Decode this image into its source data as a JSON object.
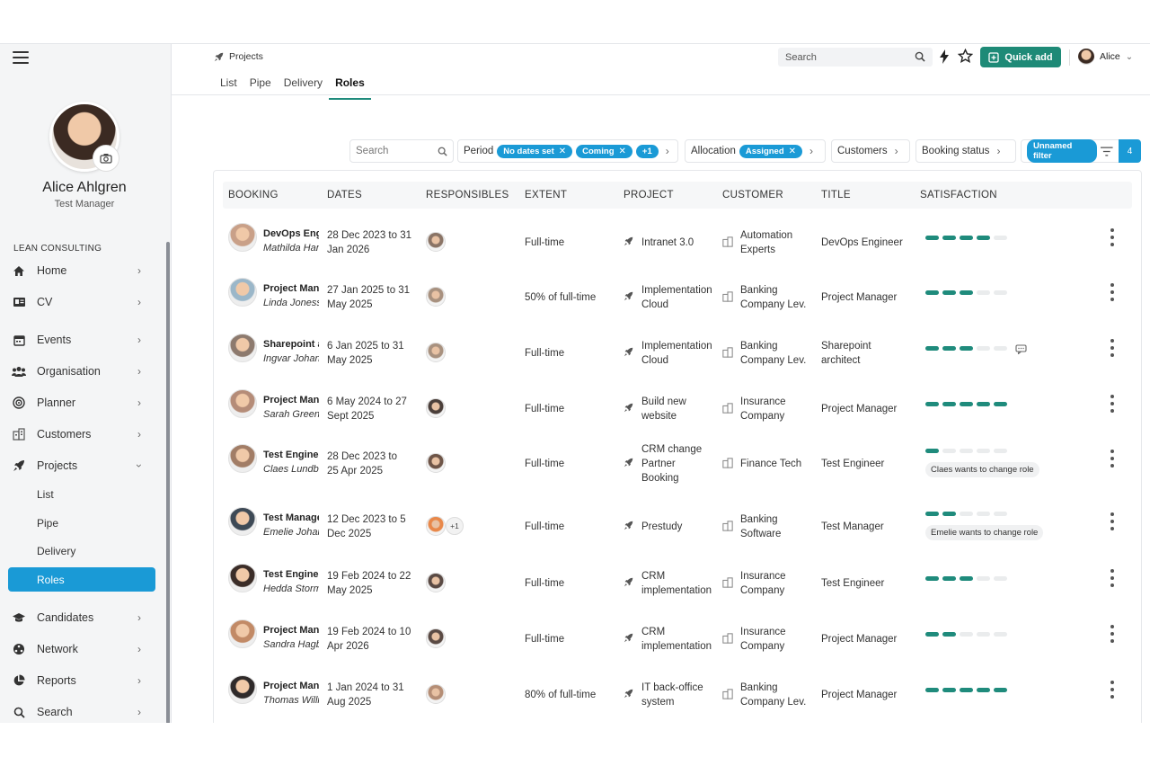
{
  "sidebar": {
    "profile_name": "Alice Ahlgren",
    "profile_role": "Test Manager",
    "org_label": "LEAN CONSULTING",
    "items": [
      {
        "label": "Home",
        "icon": "home-icon"
      },
      {
        "label": "CV",
        "icon": "cv-icon"
      },
      {
        "label": "Events",
        "icon": "calendar-icon"
      },
      {
        "label": "Organisation",
        "icon": "people-icon"
      },
      {
        "label": "Planner",
        "icon": "planner-icon"
      },
      {
        "label": "Customers",
        "icon": "building-icon"
      },
      {
        "label": "Projects",
        "icon": "rocket-icon"
      },
      {
        "label": "Candidates",
        "icon": "graduation-cap-icon"
      },
      {
        "label": "Network",
        "icon": "network-icon"
      },
      {
        "label": "Reports",
        "icon": "pie-chart-icon"
      },
      {
        "label": "Search",
        "icon": "search-icon"
      }
    ],
    "project_subitems": [
      "List",
      "Pipe",
      "Delivery",
      "Roles"
    ]
  },
  "header": {
    "breadcrumb": "Projects",
    "tabs": [
      "List",
      "Pipe",
      "Delivery",
      "Roles"
    ],
    "active_tab": "Roles",
    "search_placeholder": "Search",
    "quick_add_label": "Quick add",
    "user_name": "Alice"
  },
  "filters": {
    "search_placeholder": "Search",
    "period_label": "Period",
    "period_pills": [
      "No dates set",
      "Coming",
      "+1"
    ],
    "allocation_label": "Allocation",
    "allocation_pill": "Assigned",
    "customers_label": "Customers",
    "booking_status_label": "Booking status",
    "unnamed_filter": "Unnamed filter",
    "count": "4"
  },
  "table": {
    "columns": [
      "BOOKING",
      "DATES",
      "RESPONSIBLES",
      "EXTENT",
      "PROJECT",
      "CUSTOMER",
      "TITLE",
      "SATISFACTION"
    ],
    "rows": [
      {
        "role": "DevOps Engineer",
        "person": "Mathilda Hansson",
        "dates1": "28 Dec 2023 to 31",
        "dates2": "Jan 2026",
        "extent": "Full-time",
        "project1": "Intranet 3.0",
        "project2": "",
        "project3": "",
        "customer1": "Automation",
        "customer2": "Experts",
        "title1": "DevOps Engineer",
        "title2": "",
        "satisfaction": 4,
        "note": "",
        "avatar_color": "#c9a088",
        "resp_color": "#8a7466"
      },
      {
        "role": "Project Manager",
        "person": "Linda Jonesson",
        "dates1": "27 Jan 2025 to 31",
        "dates2": "May 2025",
        "extent": "50% of full-time",
        "project1": "Implementation",
        "project2": "Cloud",
        "project3": "",
        "customer1": "Banking",
        "customer2": "Company Lev.",
        "title1": "Project Manager",
        "title2": "",
        "satisfaction": 3,
        "note": "",
        "avatar_color": "#9bb7c9",
        "resp_color": "#a8917f"
      },
      {
        "role": "Sharepoint architect",
        "person": "Ingvar Johansson",
        "dates1": "6 Jan 2025 to 31",
        "dates2": "May 2025",
        "extent": "Full-time",
        "project1": "Implementation",
        "project2": "Cloud",
        "project3": "",
        "customer1": "Banking",
        "customer2": "Company Lev.",
        "title1": "Sharepoint",
        "title2": "architect",
        "satisfaction": 3,
        "note": "",
        "avatar_color": "#8d7a6e",
        "resp_color": "#a8917f"
      },
      {
        "role": "Project Manager",
        "person": "Sarah Green",
        "dates1": "6 May 2024 to 27",
        "dates2": "Sept 2025",
        "extent": "Full-time",
        "project1": "Build new",
        "project2": "website",
        "project3": "",
        "customer1": "Insurance",
        "customer2": "Company",
        "title1": "Project Manager",
        "title2": "",
        "satisfaction": 5,
        "note": "",
        "avatar_color": "#b58c78",
        "resp_color": "#4b3f3a"
      },
      {
        "role": "Test Engineer",
        "person": "Claes Lundberg",
        "dates1": "28 Dec 2023 to",
        "dates2": "25 Apr 2025",
        "extent": "Full-time",
        "project1": "CRM change",
        "project2": "Partner",
        "project3": "Booking",
        "customer1": "Finance Tech",
        "customer2": "",
        "title1": "Test Engineer",
        "title2": "",
        "satisfaction": 1,
        "note": "Claes wants to change role",
        "avatar_color": "#a27d66",
        "resp_color": "#6e5548"
      },
      {
        "role": "Test Manager",
        "person": "Emelie Johansson",
        "dates1": "12 Dec 2023 to 5",
        "dates2": "Dec 2025",
        "extent": "Full-time",
        "project1": "Prestudy",
        "project2": "",
        "project3": "",
        "customer1": "Banking",
        "customer2": "Software",
        "title1": "Test Manager",
        "title2": "",
        "satisfaction": 2,
        "note": "Emelie wants to change role",
        "avatar_color": "#3e4a56",
        "resp_color": "#e8884a"
      },
      {
        "role": "Test Engineer",
        "person": "Hedda Storm",
        "dates1": "19 Feb 2024 to 22",
        "dates2": "May 2025",
        "extent": "Full-time",
        "project1": "CRM",
        "project2": "implementation",
        "project3": "",
        "customer1": "Insurance",
        "customer2": "Company",
        "title1": "Test Engineer",
        "title2": "",
        "satisfaction": 3,
        "note": "",
        "avatar_color": "#3b2d28",
        "resp_color": "#5a4a44"
      },
      {
        "role": "Project Manager",
        "person": "Sandra Hagberg",
        "dates1": "19 Feb 2024 to 10",
        "dates2": "Apr 2026",
        "extent": "Full-time",
        "project1": "CRM",
        "project2": "implementation",
        "project3": "",
        "customer1": "Insurance",
        "customer2": "Company",
        "title1": "Project Manager",
        "title2": "",
        "satisfaction": 2,
        "note": "",
        "avatar_color": "#c28a66",
        "resp_color": "#5a4a44"
      },
      {
        "role": "Project Manager",
        "person": "Thomas Williams",
        "dates1": "1 Jan 2024 to 31",
        "dates2": "Aug 2025",
        "extent": "80% of full-time",
        "project1": "IT back-office",
        "project2": "system",
        "project3": "",
        "customer1": "Banking",
        "customer2": "Company Lev.",
        "title1": "Project Manager",
        "title2": "",
        "satisfaction": 5,
        "note": "",
        "avatar_color": "#2f2a2a",
        "resp_color": "#b58e76"
      }
    ]
  }
}
